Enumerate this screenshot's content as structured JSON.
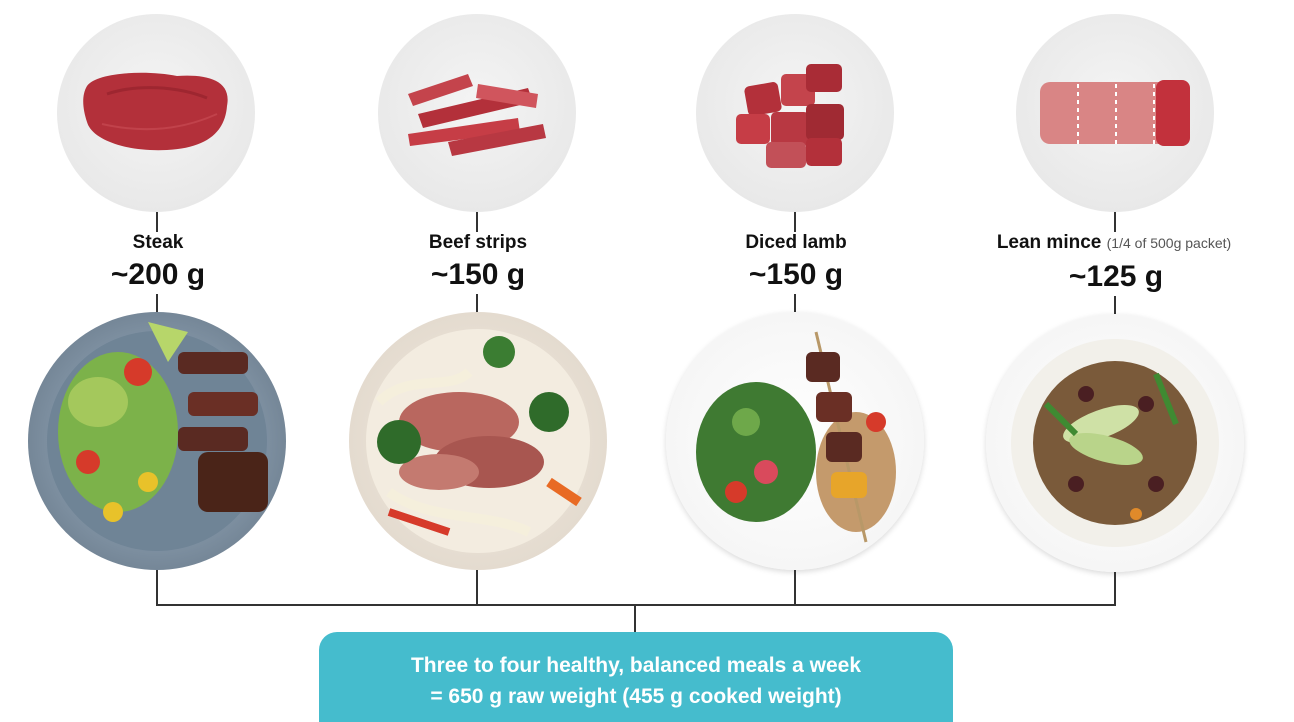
{
  "items": [
    {
      "label": "Steak",
      "note": "",
      "amount": "~200 g",
      "icon": "raw-steak-icon",
      "plate": "steak-salad-plate"
    },
    {
      "label": "Beef strips",
      "note": "",
      "amount": "~150 g",
      "icon": "raw-beef-strips-icon",
      "plate": "beef-noodle-stirfry-plate"
    },
    {
      "label": "Diced lamb",
      "note": "",
      "amount": "~150 g",
      "icon": "raw-diced-lamb-icon",
      "plate": "lamb-skewer-salad-plate"
    },
    {
      "label": "Lean mince",
      "note": "(1/4 of 500g packet)",
      "amount": "~125 g",
      "icon": "raw-lean-mince-icon",
      "plate": "mince-rice-bowl-plate"
    }
  ],
  "summary": {
    "line1": "Three to four healthy, balanced meals a week",
    "line2": "= 650 g raw weight (455 g cooked weight)"
  },
  "colors": {
    "banner": "#45bccd",
    "meat": "#b8323b",
    "connector": "#333333"
  }
}
